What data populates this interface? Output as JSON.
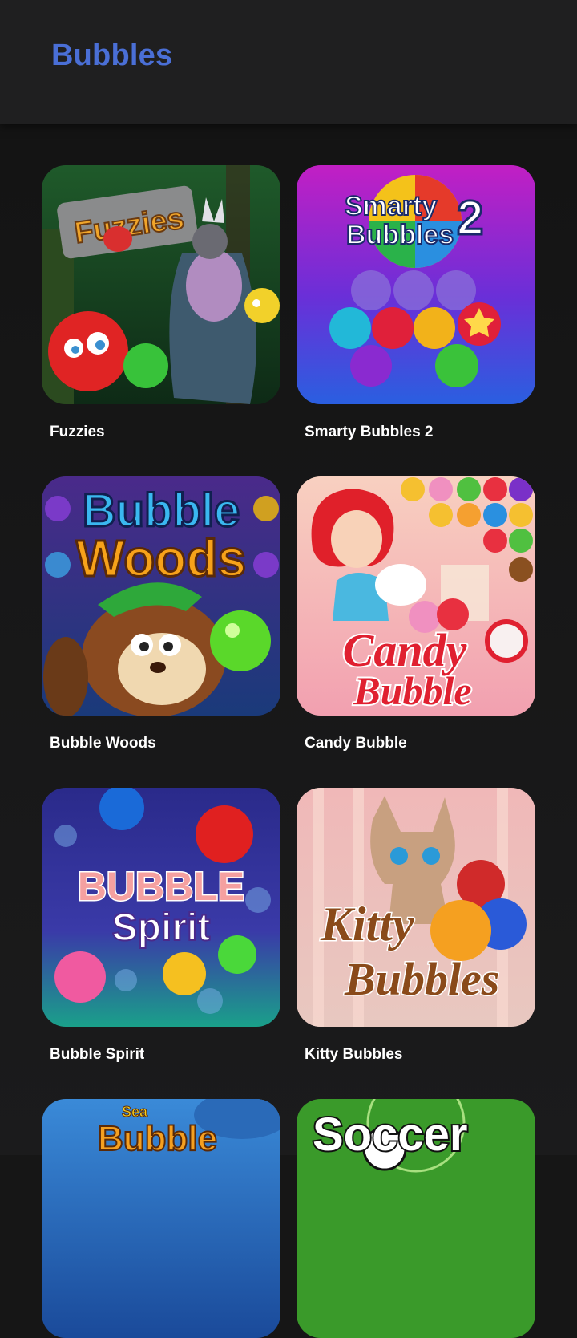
{
  "header": {
    "title": "Bubbles"
  },
  "games": [
    {
      "title": "Fuzzies",
      "art_text": "Fuzzies"
    },
    {
      "title": "Smarty Bubbles 2",
      "art_text": [
        "Smarty",
        "Bubbles",
        "2"
      ]
    },
    {
      "title": "Bubble Woods",
      "art_text": [
        "Bubble",
        "Woods"
      ]
    },
    {
      "title": "Candy Bubble",
      "art_text": [
        "Candy",
        "Bubble"
      ]
    },
    {
      "title": "Bubble Spirit",
      "art_text": [
        "BUBBLE",
        "Spirit"
      ]
    },
    {
      "title": "Kitty Bubbles",
      "art_text": [
        "Kitty",
        "Bubbles"
      ]
    },
    {
      "title": "",
      "art_text": [
        "Sea",
        "Bubble"
      ]
    },
    {
      "title": "",
      "art_text": "Soccer"
    }
  ]
}
